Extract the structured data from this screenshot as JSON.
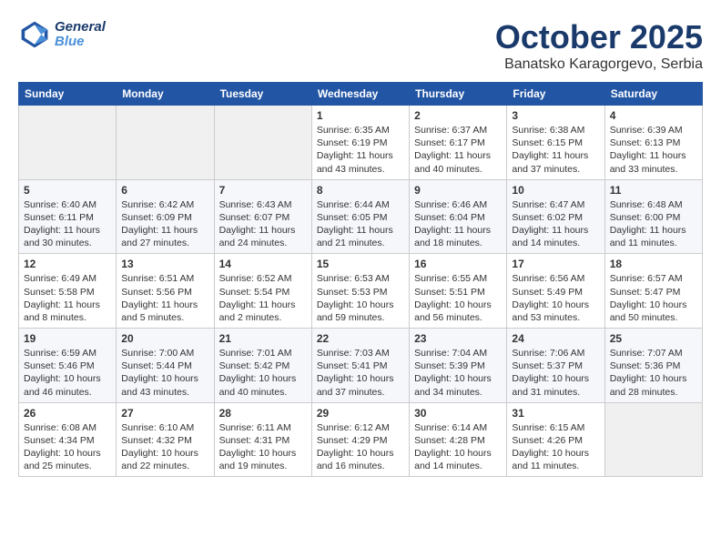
{
  "header": {
    "logo_line1": "General",
    "logo_line2": "Blue",
    "month": "October 2025",
    "location": "Banatsko Karagorgevo, Serbia"
  },
  "weekdays": [
    "Sunday",
    "Monday",
    "Tuesday",
    "Wednesday",
    "Thursday",
    "Friday",
    "Saturday"
  ],
  "weeks": [
    [
      {
        "day": "",
        "text": ""
      },
      {
        "day": "",
        "text": ""
      },
      {
        "day": "",
        "text": ""
      },
      {
        "day": "1",
        "text": "Sunrise: 6:35 AM\nSunset: 6:19 PM\nDaylight: 11 hours and 43 minutes."
      },
      {
        "day": "2",
        "text": "Sunrise: 6:37 AM\nSunset: 6:17 PM\nDaylight: 11 hours and 40 minutes."
      },
      {
        "day": "3",
        "text": "Sunrise: 6:38 AM\nSunset: 6:15 PM\nDaylight: 11 hours and 37 minutes."
      },
      {
        "day": "4",
        "text": "Sunrise: 6:39 AM\nSunset: 6:13 PM\nDaylight: 11 hours and 33 minutes."
      }
    ],
    [
      {
        "day": "5",
        "text": "Sunrise: 6:40 AM\nSunset: 6:11 PM\nDaylight: 11 hours and 30 minutes."
      },
      {
        "day": "6",
        "text": "Sunrise: 6:42 AM\nSunset: 6:09 PM\nDaylight: 11 hours and 27 minutes."
      },
      {
        "day": "7",
        "text": "Sunrise: 6:43 AM\nSunset: 6:07 PM\nDaylight: 11 hours and 24 minutes."
      },
      {
        "day": "8",
        "text": "Sunrise: 6:44 AM\nSunset: 6:05 PM\nDaylight: 11 hours and 21 minutes."
      },
      {
        "day": "9",
        "text": "Sunrise: 6:46 AM\nSunset: 6:04 PM\nDaylight: 11 hours and 18 minutes."
      },
      {
        "day": "10",
        "text": "Sunrise: 6:47 AM\nSunset: 6:02 PM\nDaylight: 11 hours and 14 minutes."
      },
      {
        "day": "11",
        "text": "Sunrise: 6:48 AM\nSunset: 6:00 PM\nDaylight: 11 hours and 11 minutes."
      }
    ],
    [
      {
        "day": "12",
        "text": "Sunrise: 6:49 AM\nSunset: 5:58 PM\nDaylight: 11 hours and 8 minutes."
      },
      {
        "day": "13",
        "text": "Sunrise: 6:51 AM\nSunset: 5:56 PM\nDaylight: 11 hours and 5 minutes."
      },
      {
        "day": "14",
        "text": "Sunrise: 6:52 AM\nSunset: 5:54 PM\nDaylight: 11 hours and 2 minutes."
      },
      {
        "day": "15",
        "text": "Sunrise: 6:53 AM\nSunset: 5:53 PM\nDaylight: 10 hours and 59 minutes."
      },
      {
        "day": "16",
        "text": "Sunrise: 6:55 AM\nSunset: 5:51 PM\nDaylight: 10 hours and 56 minutes."
      },
      {
        "day": "17",
        "text": "Sunrise: 6:56 AM\nSunset: 5:49 PM\nDaylight: 10 hours and 53 minutes."
      },
      {
        "day": "18",
        "text": "Sunrise: 6:57 AM\nSunset: 5:47 PM\nDaylight: 10 hours and 50 minutes."
      }
    ],
    [
      {
        "day": "19",
        "text": "Sunrise: 6:59 AM\nSunset: 5:46 PM\nDaylight: 10 hours and 46 minutes."
      },
      {
        "day": "20",
        "text": "Sunrise: 7:00 AM\nSunset: 5:44 PM\nDaylight: 10 hours and 43 minutes."
      },
      {
        "day": "21",
        "text": "Sunrise: 7:01 AM\nSunset: 5:42 PM\nDaylight: 10 hours and 40 minutes."
      },
      {
        "day": "22",
        "text": "Sunrise: 7:03 AM\nSunset: 5:41 PM\nDaylight: 10 hours and 37 minutes."
      },
      {
        "day": "23",
        "text": "Sunrise: 7:04 AM\nSunset: 5:39 PM\nDaylight: 10 hours and 34 minutes."
      },
      {
        "day": "24",
        "text": "Sunrise: 7:06 AM\nSunset: 5:37 PM\nDaylight: 10 hours and 31 minutes."
      },
      {
        "day": "25",
        "text": "Sunrise: 7:07 AM\nSunset: 5:36 PM\nDaylight: 10 hours and 28 minutes."
      }
    ],
    [
      {
        "day": "26",
        "text": "Sunrise: 6:08 AM\nSunset: 4:34 PM\nDaylight: 10 hours and 25 minutes."
      },
      {
        "day": "27",
        "text": "Sunrise: 6:10 AM\nSunset: 4:32 PM\nDaylight: 10 hours and 22 minutes."
      },
      {
        "day": "28",
        "text": "Sunrise: 6:11 AM\nSunset: 4:31 PM\nDaylight: 10 hours and 19 minutes."
      },
      {
        "day": "29",
        "text": "Sunrise: 6:12 AM\nSunset: 4:29 PM\nDaylight: 10 hours and 16 minutes."
      },
      {
        "day": "30",
        "text": "Sunrise: 6:14 AM\nSunset: 4:28 PM\nDaylight: 10 hours and 14 minutes."
      },
      {
        "day": "31",
        "text": "Sunrise: 6:15 AM\nSunset: 4:26 PM\nDaylight: 10 hours and 11 minutes."
      },
      {
        "day": "",
        "text": ""
      }
    ]
  ]
}
